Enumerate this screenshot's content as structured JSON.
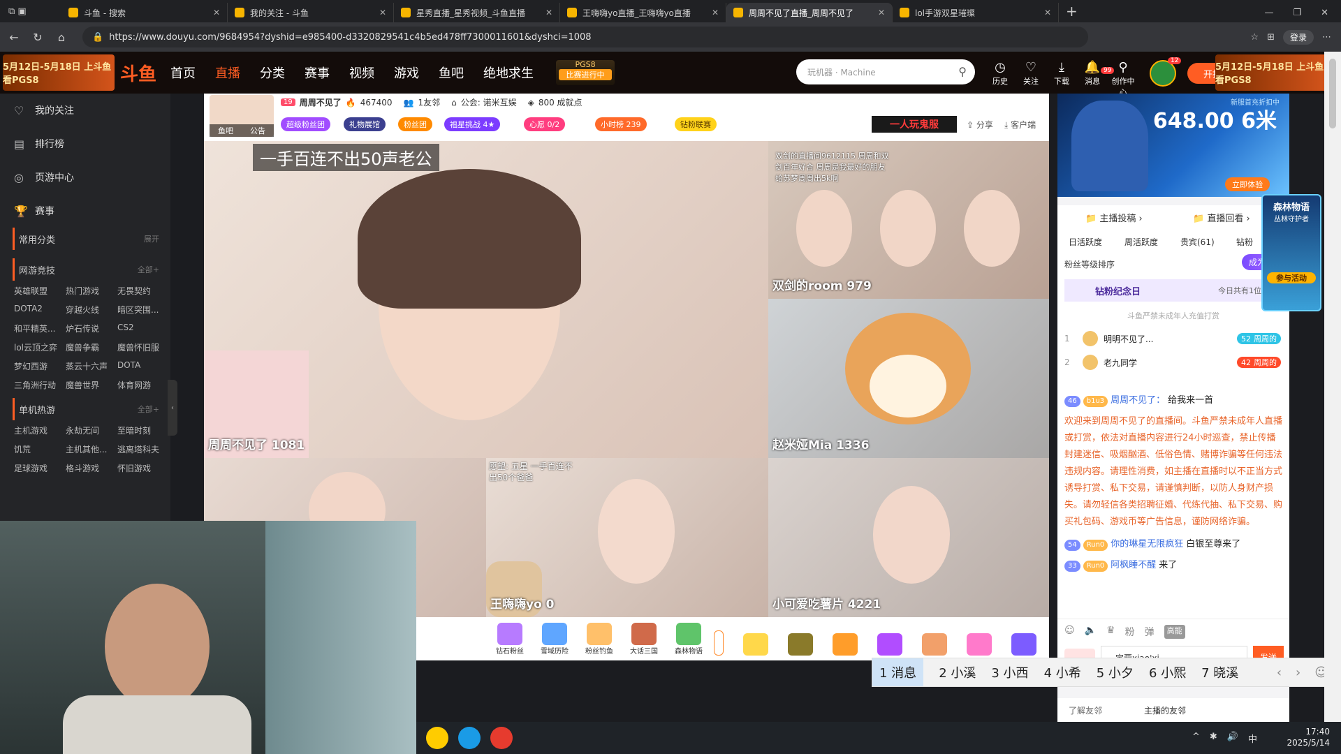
{
  "browser": {
    "tabs": [
      {
        "title": "斗鱼 - 搜索",
        "active": false
      },
      {
        "title": "我的关注 - 斗鱼",
        "active": false
      },
      {
        "title": "星秀直播_星秀视频_斗鱼直播",
        "active": false
      },
      {
        "title": "王嗨嗨yo直播_王嗨嗨yo直播",
        "active": false
      },
      {
        "title": "周周不见了直播_周周不见了",
        "active": true
      },
      {
        "title": "lol手游双星璀璨",
        "active": false
      }
    ],
    "new_tab": "+",
    "url": "https://www.douyu.com/9684954?dyshid=e985400-d3320829541c4b5ed478ff7300011601&dyshci=1008",
    "login_label": "登录"
  },
  "header": {
    "promo_left": "5月12日-5月18日 上斗鱼看PGS8",
    "logo": "斗鱼",
    "nav": [
      {
        "label": "首页",
        "active": false
      },
      {
        "label": "直播",
        "active": true
      },
      {
        "label": "分类",
        "active": false
      },
      {
        "label": "赛事",
        "active": false
      },
      {
        "label": "视频",
        "active": false
      },
      {
        "label": "游戏",
        "active": false
      },
      {
        "label": "鱼吧",
        "active": false
      },
      {
        "label": "绝地求生",
        "active": false
      }
    ],
    "event_badge_top": "PGS8",
    "event_badge_bottom": "比赛进行中",
    "search_placeholder": "玩机器 · Machine",
    "icons": [
      {
        "name": "历史",
        "glyph": "◷"
      },
      {
        "name": "关注",
        "glyph": "♡"
      },
      {
        "name": "下载",
        "glyph": "⤓"
      },
      {
        "name": "消息",
        "glyph": "🔔"
      },
      {
        "name": "创作中心",
        "glyph": "⚲"
      }
    ],
    "msg_count": "99",
    "avatar_count": "12",
    "live_btn": "开播",
    "promo_right": "5月12日-5月18日 上斗鱼看PGS8"
  },
  "sidebar": {
    "items": [
      {
        "label": "我的关注",
        "glyph": "♡"
      },
      {
        "label": "排行榜",
        "glyph": "▤"
      },
      {
        "label": "页游中心",
        "glyph": "◎"
      },
      {
        "label": "赛事",
        "glyph": "🏆"
      }
    ],
    "sections": [
      {
        "title": "常用分类",
        "more": "展开",
        "games": []
      },
      {
        "title": "网游竞技",
        "more": "全部+",
        "games": [
          "英雄联盟",
          "热门游戏",
          "无畏契约",
          "DOTA2",
          "穿越火线",
          "暗区突围...",
          "和平精英...",
          "炉石传说",
          "CS2",
          "lol云顶之弈",
          "魔兽争霸",
          "魔兽怀旧服",
          "梦幻西游",
          "蒸云十六声",
          "DOTA",
          "三角洲行动",
          "魔兽世界",
          "体育网游"
        ]
      },
      {
        "title": "单机热游",
        "more": "全部+",
        "games": [
          "主机游戏",
          "永劫无间",
          "至暗时刻",
          "饥荒",
          "主机其他...",
          "逃离塔科夫",
          "足球游戏",
          "格斗游戏",
          "怀旧游戏"
        ]
      }
    ]
  },
  "room": {
    "level": "19",
    "anchor_name": "周周不见了",
    "hot": "467400",
    "fans_online": "1友邻",
    "guild": "公会: 诺米互娱",
    "points": "800 成就点",
    "tabs_left": [
      "鱼吧",
      "公告"
    ],
    "badges": [
      "超级粉丝团",
      "礼物展馆",
      "粉丝团",
      "福星挑战 4★",
      "心愿 0/2",
      "小时榜 239",
      "钻粉联赛"
    ],
    "badge_colors": [
      "#a14cff",
      "#3b3f8f",
      "#ff8a00",
      "#7c3cff",
      "#ff3d7f",
      "#ff6a2a",
      "#ffd21a"
    ],
    "activity_tag": "一人玩鬼服",
    "share": "分享",
    "client": "客户端"
  },
  "player": {
    "banner_text": "一手百连不出50声老公",
    "tiles": [
      {
        "name": "周周不见了 1081",
        "bg": "#e9d7cf"
      },
      {
        "name": "双剑的room 979",
        "bg": "#cbb6a8",
        "caption": "双剑的直播间9612115 周周和双剑百年好合 周周是我最好的朋友 给苏梦周周出5k啊"
      },
      {
        "name": "赵米娅Mia 1336",
        "bg": "#c9c4c2"
      },
      {
        "name": "",
        "bg": "#d7c6bd"
      },
      {
        "name": "王嗨嗨yo 0",
        "bg": "#e3d5cc",
        "caption": "愿望: 五星 一手百连不出50个爸爸"
      },
      {
        "name": "小可爱吃薯片 4221",
        "bg": "#d5cbc6"
      }
    ]
  },
  "gifts": [
    {
      "label": "钻石粉丝",
      "color": "#b77bff"
    },
    {
      "label": "雪域历险",
      "color": "#5fa6ff"
    },
    {
      "label": "粉丝钓鱼",
      "color": "#ffc06a"
    },
    {
      "label": "大话三国",
      "color": "#d06a4a"
    },
    {
      "label": "森林物语",
      "color": "#5fc46a"
    },
    {
      "label": "",
      "color": "#ffd84a"
    },
    {
      "label": "",
      "color": "#8a7a2a"
    },
    {
      "label": "",
      "color": "#ff9d2a"
    },
    {
      "label": "",
      "color": "#b14dff"
    },
    {
      "label": "",
      "color": "#f2a06a"
    },
    {
      "label": "",
      "color": "#ff7acb"
    },
    {
      "label": "",
      "color": "#7c5cff"
    }
  ],
  "ad": {
    "price": "648.00 6米",
    "subtitle": "新服首充折扣中",
    "cta": "立即体验"
  },
  "sky_panel": {
    "title": "森林物语",
    "sub": "丛林守护者",
    "cta": "参与活动"
  },
  "rank": {
    "links": [
      "主播投稿",
      "直播回看"
    ],
    "tabs": [
      "日活跃度",
      "周活跃度",
      "贵宾(61)",
      "钻粉"
    ],
    "sort_label": "粉丝等级排序",
    "become_btn": "成为钻粉",
    "anniversary": "钻粉纪念日",
    "anniv_note": "今日共有1位粉丝",
    "notice": "斗鱼严禁未成年人充值打赏",
    "rows": [
      {
        "rank": "1",
        "name": "明明不见了...",
        "level": "52",
        "tag": "周周的"
      },
      {
        "rank": "2",
        "name": "老九同学",
        "level": "42",
        "tag": "周周的"
      }
    ]
  },
  "chat": {
    "messages": [
      {
        "lvl": "46",
        "badge": "b1u3",
        "user": "周周不见了：",
        "text": "给我来一首"
      },
      {
        "system": "欢迎来到周周不见了的直播间。斗鱼严禁未成年人直播或打赏，依法对直播内容进行24小时巡查，禁止传播封建迷信、吸烟酗酒、低俗色情、赌博诈骗等任何违法违规内容。请理性消费，如主播在直播时以不正当方式诱导打赏、私下交易，请谨慎判断，以防人身财产损失。请勿轻信各类招聘征婚、代练代抽、私下交易、购买礼包码、游戏币等广告信息，谨防网络诈骗。"
      },
      {
        "lvl": "54",
        "badge": "Run0",
        "user": "你的琳星无限疯狂",
        "text": "白银至尊来了"
      },
      {
        "lvl": "33",
        "badge": "Run0",
        "user": "阿枫睡不醒",
        "text": "来了"
      }
    ],
    "input_value": "一定要xiao'xi",
    "send_label": "发送",
    "tool_label": "高能"
  },
  "friends": {
    "label": "了解友邻",
    "value": "主播的友邻"
  },
  "ime": {
    "candidates": [
      "1 消息",
      "2 小溪",
      "3 小西",
      "4 小希",
      "5 小夕",
      "6 小熙",
      "7 晓溪"
    ]
  },
  "taskbar": {
    "time": "17:40",
    "date": "2025/5/14",
    "ime_lang": "中"
  }
}
